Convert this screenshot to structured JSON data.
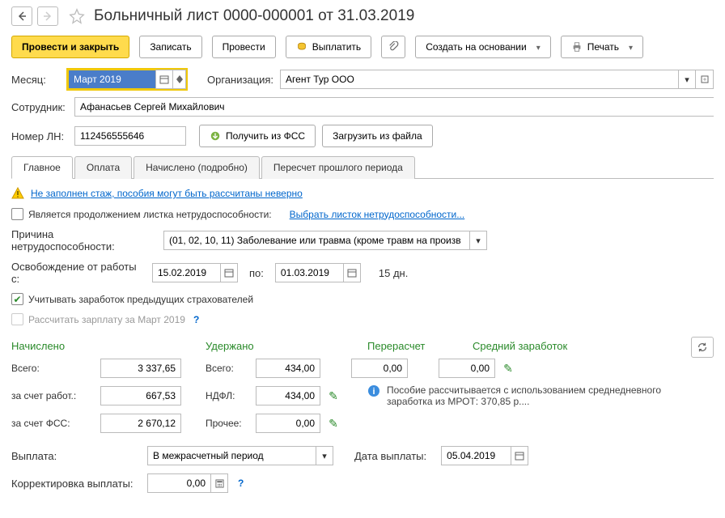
{
  "title": "Больничный лист 0000-000001 от 31.03.2019",
  "toolbar": {
    "primary": "Провести и закрыть",
    "save": "Записать",
    "post": "Провести",
    "pay": "Выплатить",
    "create_based": "Создать на основании",
    "print": "Печать"
  },
  "fields": {
    "month_label": "Месяц:",
    "month_value": "Март 2019",
    "org_label": "Организация:",
    "org_value": "Агент Тур ООО",
    "employee_label": "Сотрудник:",
    "employee_value": "Афанасьев Сергей Михайлович",
    "ln_label": "Номер ЛН:",
    "ln_value": "112456555646",
    "get_fss": "Получить из ФСС",
    "load_file": "Загрузить из файла"
  },
  "tabs": {
    "main": "Главное",
    "payment": "Оплата",
    "accrued": "Начислено (подробно)",
    "recalc": "Пересчет прошлого периода"
  },
  "warning": "Не заполнен стаж, пособия могут быть рассчитаны неверно",
  "continuation": {
    "label": "Является продолжением листка нетрудоспособности:",
    "link": "Выбрать листок нетрудоспособности..."
  },
  "reason": {
    "label": "Причина нетрудоспособности:",
    "value": "(01, 02, 10, 11) Заболевание или травма (кроме травм на произв"
  },
  "release": {
    "label": "Освобождение от работы с:",
    "from": "15.02.2019",
    "to_label": "по:",
    "to": "01.03.2019",
    "days": "15 дн."
  },
  "prev_insurers": "Учитывать заработок предыдущих страхователей",
  "recalc_salary": "Рассчитать зарплату за Март 2019",
  "sections": {
    "accrued": "Начислено",
    "withheld": "Удержано",
    "recalc": "Перерасчет",
    "avg": "Средний заработок"
  },
  "calc": {
    "total_label": "Всего:",
    "total_accrued": "3 337,65",
    "total_withheld": "434,00",
    "recalc_val": "0,00",
    "avg_val": "0,00",
    "employer_label": "за счет работ.:",
    "employer_val": "667,53",
    "ndfl_label": "НДФЛ:",
    "ndfl_val": "434,00",
    "fss_label": "за счет ФСС:",
    "fss_val": "2 670,12",
    "other_label": "Прочее:",
    "other_val": "0,00",
    "info": "Пособие рассчитывается с использованием среднедневного заработка из МРОТ: 370,85 р...."
  },
  "payout": {
    "label": "Выплата:",
    "value": "В межрасчетный период",
    "date_label": "Дата выплаты:",
    "date_value": "05.04.2019",
    "corr_label": "Корректировка выплаты:",
    "corr_value": "0,00"
  }
}
